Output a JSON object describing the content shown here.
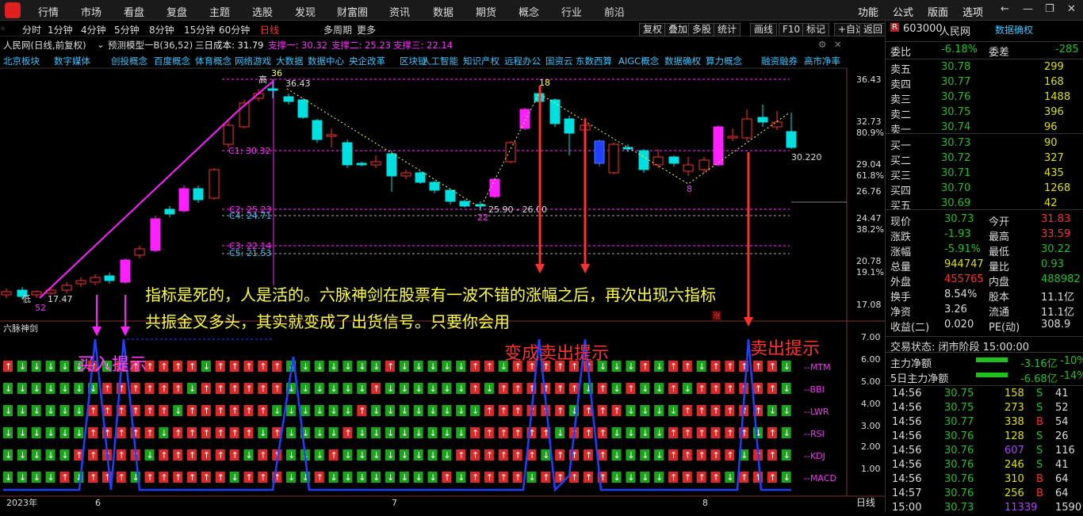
{
  "menu": {
    "items": [
      "行情",
      "市场",
      "看盘",
      "复盘",
      "主题",
      "选股",
      "发现",
      "财富圈",
      "资讯",
      "数据",
      "期货",
      "概念",
      "行业",
      "前沿"
    ],
    "right": [
      "功能",
      "公式",
      "版面",
      "选项"
    ]
  },
  "period": {
    "items": [
      "分时",
      "1分钟",
      "4分钟",
      "5分钟",
      "8分钟",
      "15分钟",
      "60分钟",
      "日线",
      "多周期",
      "更多"
    ],
    "active": "日线",
    "buttons": [
      "复权",
      "叠加",
      "多股",
      "统计",
      "画线",
      "F10",
      "标记",
      "+自选",
      "返回"
    ]
  },
  "info": {
    "stock": "人民网(日线,前复权)",
    "model": "预测模型一B(36,52)",
    "cost": "三日成本: 31.79",
    "s1": "支撑一: 30.32",
    "s2": "支撑二: 25.23",
    "s3": "支撑三: 22.14"
  },
  "concepts": [
    "北京板块",
    "数字媒体",
    "创投概念",
    "百度概念",
    "体育概念",
    "网络游戏",
    "大数据",
    "数据中心",
    "央企改革",
    "区块链",
    "人工智能",
    "知识产权",
    "远程办公",
    "国资云",
    "东数西算",
    "AIGC概念",
    "数据确权",
    "算力概念",
    "融资融券",
    "高市净率"
  ],
  "price_axis": [
    "36.43",
    "32.73",
    "80.9%",
    "29.04",
    "61.8%",
    "26.76",
    "24.47",
    "38.2%",
    "20.78",
    "19.1%",
    "17.08"
  ],
  "price_labels": {
    "high": "高",
    "high_val": "36.43",
    "high_count": "36",
    "low": "低",
    "low_val": "17.47",
    "low_count": "52",
    "last": "30.220",
    "range": "25.90 - 26.00",
    "c1": "C1: 30.32",
    "c2": "C2: 25.23",
    "c4": "C4: 24.71",
    "c3": "C3: 22.14",
    "c5": "C5: 21.53",
    "n18": "18",
    "n22": "22",
    "n8": "8",
    "zhang": "涨"
  },
  "indicator": {
    "name": "六脉神剑",
    "axis": [
      "7.00",
      "6.00",
      "5.00",
      "4.00",
      "3.00",
      "2.00",
      "1.00"
    ],
    "rows": [
      "MTM",
      "BBI",
      "LWR",
      "RSI",
      "KDJ",
      "MACD"
    ]
  },
  "time_axis": [
    "2023年",
    "6",
    "7",
    "8"
  ],
  "bottom_tab": "日线",
  "annotations": {
    "main": "指标是死的，人是活的。六脉神剑在股票有一波不错的涨幅之后，再次出现六指标",
    "main2": "共振金叉多头，其实就变成了出货信号。只要你会用",
    "buy": "买入提示",
    "sell1": "变成卖出提示",
    "sell2": "卖出提示"
  },
  "right": {
    "code": "603000",
    "name": "人民网",
    "tag": "数据确权",
    "weibi_label": "委比",
    "weibi": "-6.18%",
    "weicha_label": "委差",
    "weicha": "-285",
    "asks": [
      {
        "label": "卖五",
        "price": "30.78",
        "vol": "299"
      },
      {
        "label": "卖四",
        "price": "30.77",
        "vol": "168"
      },
      {
        "label": "卖三",
        "price": "30.76",
        "vol": "1488"
      },
      {
        "label": "卖二",
        "price": "30.75",
        "vol": "396"
      },
      {
        "label": "卖一",
        "price": "30.74",
        "vol": "96"
      }
    ],
    "bids": [
      {
        "label": "买一",
        "price": "30.73",
        "vol": "90"
      },
      {
        "label": "买二",
        "price": "30.72",
        "vol": "327"
      },
      {
        "label": "买三",
        "price": "30.71",
        "vol": "435"
      },
      {
        "label": "买四",
        "price": "30.70",
        "vol": "1268"
      },
      {
        "label": "买五",
        "price": "30.69",
        "vol": "42"
      }
    ],
    "stats": [
      {
        "l1": "现价",
        "v1": "30.73",
        "c1": "#20c020",
        "l2": "今开",
        "v2": "31.83",
        "c2": "#ff3030"
      },
      {
        "l1": "涨跌",
        "v1": "-1.93",
        "c1": "#20c020",
        "l2": "最高",
        "v2": "33.59",
        "c2": "#ff3030"
      },
      {
        "l1": "涨幅",
        "v1": "-5.91%",
        "c1": "#20c020",
        "l2": "最低",
        "v2": "30.22",
        "c2": "#20c020"
      },
      {
        "l1": "总量",
        "v1": "944747",
        "c1": "#e0e000",
        "l2": "量比",
        "v2": "0.93",
        "c2": "#20c020"
      },
      {
        "l1": "外盘",
        "v1": "455765",
        "c1": "#ff3030",
        "l2": "内盘",
        "v2": "488982",
        "c2": "#20c020"
      },
      {
        "l1": "换手",
        "v1": "8.54%",
        "c1": "#ddd",
        "l2": "股本",
        "v2": "11.1亿",
        "c2": "#ddd"
      },
      {
        "l1": "净资",
        "v1": "3.26",
        "c1": "#ddd",
        "l2": "流通",
        "v2": "11.1亿",
        "c2": "#ddd"
      },
      {
        "l1": "收益(二)",
        "v1": "0.020",
        "c1": "#ddd",
        "l2": "PE(动)",
        "v2": "308.9",
        "c2": "#ddd"
      }
    ],
    "trade_status": "交易状态: 闭市阶段 15:00:00",
    "flow1_label": "主力净额",
    "flow1_val": "-3.16亿",
    "flow1_pct": "-10%",
    "flow2_label": "5日主力净额",
    "flow2_val": "-6.68亿",
    "flow2_pct": "-14%",
    "ticks": [
      {
        "t": "14:56",
        "p": "30.75",
        "v": "158",
        "s": "S",
        "n": "41",
        "vc": "#e0e000"
      },
      {
        "t": "14:56",
        "p": "30.75",
        "v": "273",
        "s": "S",
        "n": "52",
        "vc": "#e0e000"
      },
      {
        "t": "14:56",
        "p": "30.77",
        "v": "338",
        "s": "B",
        "n": "54",
        "vc": "#e0e000"
      },
      {
        "t": "14:56",
        "p": "30.76",
        "v": "128",
        "s": "S",
        "n": "26",
        "vc": "#e0e000"
      },
      {
        "t": "14:56",
        "p": "30.76",
        "v": "607",
        "s": "S",
        "n": "116",
        "vc": "#b040ff"
      },
      {
        "t": "14:56",
        "p": "30.76",
        "v": "246",
        "s": "S",
        "n": "41",
        "vc": "#e0e000"
      },
      {
        "t": "14:56",
        "p": "30.76",
        "v": "310",
        "s": "B",
        "n": "64",
        "vc": "#e0e000"
      },
      {
        "t": "14:57",
        "p": "30.76",
        "v": "256",
        "s": "B",
        "n": "64",
        "vc": "#e0e000"
      },
      {
        "t": "15:00",
        "p": "30.73",
        "v": "11339",
        "s": "",
        "n": "1590",
        "vc": "#b040ff"
      }
    ]
  },
  "colors": {
    "up": "#ff3030",
    "down": "#00e0e0",
    "magenta": "#ff20ff",
    "blue": "#2040ff",
    "yellow": "#ffff40",
    "green": "#20c020"
  }
}
